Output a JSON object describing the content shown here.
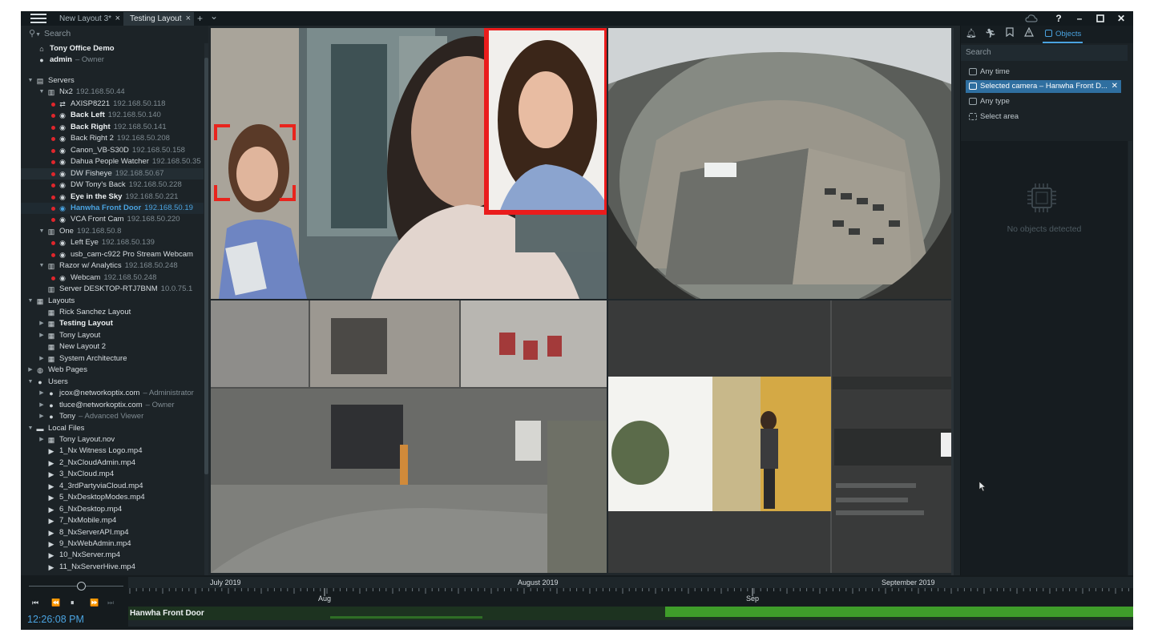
{
  "titlebar": {
    "tabs": [
      {
        "label": "New Layout 3*"
      },
      {
        "label": "Testing Layout"
      }
    ],
    "close_symbol": "×",
    "add_symbol": "+",
    "dropdown_symbol": "⌄",
    "help_symbol": "?",
    "minimize_symbol": "–",
    "close_window_symbol": "✕"
  },
  "left_panel": {
    "search_placeholder": "Search",
    "header": {
      "system_name": "Tony Office Demo",
      "user": "admin",
      "user_role": "– Owner"
    },
    "tree": [
      {
        "indent": 0,
        "arrow": "▼",
        "icon": "servers-icon",
        "name": "Servers",
        "sub": "",
        "bold": false
      },
      {
        "indent": 1,
        "arrow": "▼",
        "icon": "server-icon",
        "name": "Nx2",
        "sub": "192.168.50.44",
        "bold": false
      },
      {
        "indent": 2,
        "dot": true,
        "icon": "io-module-icon",
        "name": "AXISP8221",
        "sub": "192.168.50.118",
        "bold": false
      },
      {
        "indent": 2,
        "dot": true,
        "icon": "camera-icon",
        "name": "Back Left",
        "sub": "192.168.50.140",
        "bold": true
      },
      {
        "indent": 2,
        "dot": true,
        "icon": "camera-icon",
        "name": "Back Right",
        "sub": "192.168.50.141",
        "bold": true
      },
      {
        "indent": 2,
        "dot": true,
        "icon": "camera-icon",
        "name": "Back Right 2",
        "sub": "192.168.50.208",
        "bold": false
      },
      {
        "indent": 2,
        "dot": true,
        "icon": "camera-icon",
        "name": "Canon_VB-S30D",
        "sub": "192.168.50.158",
        "bold": false
      },
      {
        "indent": 2,
        "dot": true,
        "icon": "camera-icon",
        "name": "Dahua People Watcher",
        "sub": "192.168.50.35",
        "bold": false
      },
      {
        "indent": 2,
        "dot": true,
        "icon": "camera-icon",
        "name": "DW Fisheye",
        "sub": "192.168.50.67",
        "bold": false,
        "highlight": true
      },
      {
        "indent": 2,
        "dot": true,
        "icon": "camera-icon",
        "name": "DW Tony's Back",
        "sub": "192.168.50.228",
        "bold": false
      },
      {
        "indent": 2,
        "dot": true,
        "icon": "camera-icon",
        "name": "Eye in the Sky",
        "sub": "192.168.50.221",
        "bold": true
      },
      {
        "indent": 2,
        "dot": true,
        "icon": "camera-icon",
        "name": "Hanwha Front Door",
        "sub": "192.168.50.19",
        "bold": false,
        "selected": true
      },
      {
        "indent": 2,
        "dot": true,
        "icon": "camera-icon",
        "name": "VCA Front Cam",
        "sub": "192.168.50.220",
        "bold": false
      },
      {
        "indent": 1,
        "arrow": "▼",
        "icon": "server-icon",
        "name": "One",
        "sub": "192.168.50.8",
        "bold": false
      },
      {
        "indent": 2,
        "dot": true,
        "icon": "camera-icon",
        "name": "Left Eye",
        "sub": "192.168.50.139",
        "bold": false
      },
      {
        "indent": 2,
        "dot": true,
        "icon": "camera-icon",
        "name": "usb_cam-c922 Pro Stream Webcam",
        "sub": "",
        "bold": false
      },
      {
        "indent": 1,
        "arrow": "▼",
        "icon": "server-icon",
        "name": "Razor w/ Analytics",
        "sub": "192.168.50.248",
        "bold": false
      },
      {
        "indent": 2,
        "dot": true,
        "icon": "camera-icon",
        "name": "Webcam",
        "sub": "192.168.50.248",
        "bold": false
      },
      {
        "indent": 1,
        "icon": "server-icon",
        "name": "Server DESKTOP-RTJ7BNM",
        "sub": "10.0.75.1",
        "bold": false
      },
      {
        "indent": 0,
        "arrow": "▼",
        "icon": "layouts-icon",
        "name": "Layouts",
        "sub": "",
        "bold": false
      },
      {
        "indent": 1,
        "icon": "layout-icon",
        "name": "Rick Sanchez Layout",
        "sub": "",
        "bold": false
      },
      {
        "indent": 1,
        "arrow": "▶",
        "icon": "layout-icon",
        "name": "Testing Layout",
        "sub": "",
        "bold": true
      },
      {
        "indent": 1,
        "arrow": "▶",
        "icon": "layout-icon",
        "name": "Tony Layout",
        "sub": "",
        "bold": false
      },
      {
        "indent": 1,
        "icon": "layout-icon",
        "name": "New Layout 2",
        "sub": "",
        "bold": false
      },
      {
        "indent": 1,
        "arrow": "▶",
        "icon": "layout-icon",
        "name": "System Architecture",
        "sub": "",
        "bold": false
      },
      {
        "indent": 0,
        "arrow": "▶",
        "icon": "globe-icon",
        "name": "Web Pages",
        "sub": "",
        "bold": false
      },
      {
        "indent": 0,
        "arrow": "▼",
        "icon": "users-icon",
        "name": "Users",
        "sub": "",
        "bold": false
      },
      {
        "indent": 1,
        "arrow": "▶",
        "icon": "user-icon",
        "name": "jcox@networkoptix.com",
        "sub": "– Administrator",
        "bold": false
      },
      {
        "indent": 1,
        "arrow": "▶",
        "icon": "user-icon",
        "name": "tluce@networkoptix.com",
        "sub": "– Owner",
        "bold": false
      },
      {
        "indent": 1,
        "arrow": "▶",
        "icon": "user-icon",
        "name": "Tony",
        "sub": "– Advanced Viewer",
        "bold": false
      },
      {
        "indent": 0,
        "arrow": "▼",
        "icon": "folder-icon",
        "name": "Local Files",
        "sub": "",
        "bold": false
      },
      {
        "indent": 1,
        "arrow": "▶",
        "icon": "layout-icon",
        "name": "Tony Layout.nov",
        "sub": "",
        "bold": false
      },
      {
        "indent": 1,
        "icon": "video-file-icon",
        "name": "1_Nx Witness Logo.mp4",
        "sub": "",
        "bold": false
      },
      {
        "indent": 1,
        "icon": "video-file-icon",
        "name": "2_NxCloudAdmin.mp4",
        "sub": "",
        "bold": false
      },
      {
        "indent": 1,
        "icon": "video-file-icon",
        "name": "3_NxCloud.mp4",
        "sub": "",
        "bold": false
      },
      {
        "indent": 1,
        "icon": "video-file-icon",
        "name": "4_3rdPartyviaCloud.mp4",
        "sub": "",
        "bold": false
      },
      {
        "indent": 1,
        "icon": "video-file-icon",
        "name": "5_NxDesktopModes.mp4",
        "sub": "",
        "bold": false
      },
      {
        "indent": 1,
        "icon": "video-file-icon",
        "name": "6_NxDesktop.mp4",
        "sub": "",
        "bold": false
      },
      {
        "indent": 1,
        "icon": "video-file-icon",
        "name": "7_NxMobile.mp4",
        "sub": "",
        "bold": false
      },
      {
        "indent": 1,
        "icon": "video-file-icon",
        "name": "8_NxServerAPI.mp4",
        "sub": "",
        "bold": false
      },
      {
        "indent": 1,
        "icon": "video-file-icon",
        "name": "9_NxWebAdmin.mp4",
        "sub": "",
        "bold": false
      },
      {
        "indent": 1,
        "icon": "video-file-icon",
        "name": "10_NxServer.mp4",
        "sub": "",
        "bold": false
      },
      {
        "indent": 1,
        "icon": "video-file-icon",
        "name": "11_NxServerHive.mp4",
        "sub": "",
        "bold": false
      }
    ]
  },
  "right_panel": {
    "tab_label": "Objects",
    "search_placeholder": "Search",
    "filters": [
      {
        "label": "Any time",
        "active": false
      },
      {
        "label": "Selected camera – Hanwha Front D...",
        "active": true
      },
      {
        "label": "Any type",
        "active": false
      },
      {
        "label": "Select area",
        "active": false
      }
    ],
    "empty_text": "No objects detected"
  },
  "timeline": {
    "clock": "12:26:08 PM",
    "months": [
      "July 2019",
      "August 2019",
      "September 2019"
    ],
    "sub_months": [
      "Aug",
      "Sep"
    ],
    "camera_label": "Hanwha Front Door",
    "volume_level": 0.55,
    "colors": {
      "recording": "#3f9d2a",
      "recording_dim": "#2f6e26",
      "accent": "#4aa3e0"
    }
  }
}
